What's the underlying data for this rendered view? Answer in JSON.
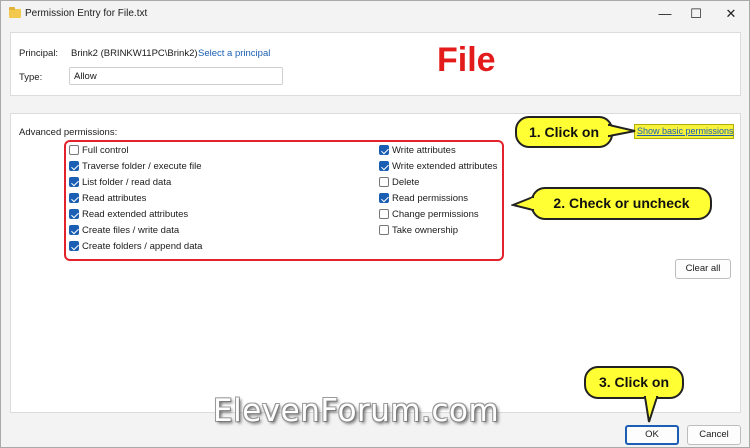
{
  "window": {
    "title": "Permission Entry for File.txt",
    "controls": {
      "minimize": "—",
      "maximize": "☐",
      "close": "✕"
    }
  },
  "principal": {
    "label": "Principal:",
    "value": "Brink2 (BRINKW11PC\\Brink2)",
    "select_link": "Select a principal"
  },
  "type": {
    "label": "Type:",
    "value": "Allow"
  },
  "annotation_title": "File",
  "advanced": {
    "label": "Advanced permissions:",
    "show_basic_link": "Show basic permissions",
    "left_column": [
      {
        "label": "Full control",
        "checked": false
      },
      {
        "label": "Traverse folder / execute file",
        "checked": true
      },
      {
        "label": "List folder / read data",
        "checked": true
      },
      {
        "label": "Read attributes",
        "checked": true
      },
      {
        "label": "Read extended attributes",
        "checked": true
      },
      {
        "label": "Create files / write data",
        "checked": true
      },
      {
        "label": "Create folders / append data",
        "checked": true
      }
    ],
    "right_column": [
      {
        "label": "Write attributes",
        "checked": true
      },
      {
        "label": "Write extended attributes",
        "checked": true
      },
      {
        "label": "Delete",
        "checked": false
      },
      {
        "label": "Read permissions",
        "checked": true
      },
      {
        "label": "Change permissions",
        "checked": false
      },
      {
        "label": "Take ownership",
        "checked": false
      }
    ],
    "clear_all": "Clear all"
  },
  "footer": {
    "ok": "OK",
    "cancel": "Cancel"
  },
  "callouts": {
    "step1": "1. Click on",
    "step2": "2. Check or uncheck",
    "step3": "3. Click on"
  },
  "watermark": "ElevenForum.com",
  "colors": {
    "accent": "#1a5fb4",
    "callout_fill": "#ffff33",
    "annotation_red": "#e31b1b"
  }
}
